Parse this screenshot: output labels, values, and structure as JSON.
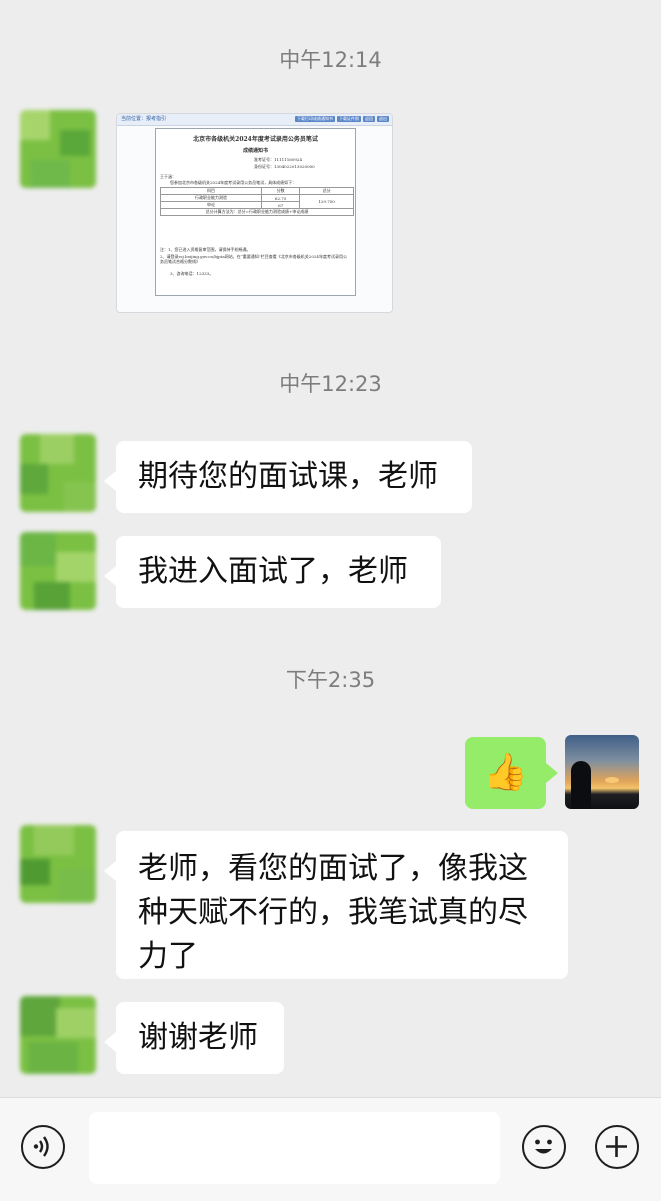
{
  "timestamps": [
    "中午12:14",
    "中午12:23",
    "下午2:35"
  ],
  "document_image": {
    "toolbar_label": "当前位置：报考指引",
    "toolbar_buttons": [
      "下载打印成绩通知书",
      "下载证件照",
      "返回",
      "退出"
    ],
    "title": "北京市各级机关2024年度考试录用公务员笔试",
    "subtitle": "成绩通知书",
    "exam_id_label": "准考证号：",
    "exam_id": "11111160924",
    "id_label": "身份证号：",
    "id_number": "1304022013020000",
    "greeting": "王于涵：",
    "body": "您参加北京市各级机关2024年度考试录用公务员笔试，具体成绩如下：",
    "table": {
      "headers": [
        "科目",
        "分数",
        "总分"
      ],
      "rows": [
        [
          "行政职业能力测验",
          "62.75",
          "129.750"
        ],
        [
          "申论",
          "67",
          ""
        ]
      ],
      "note": "总分计算方法为：总分=行政职业能力测验成绩+申论成绩"
    },
    "notes": [
      "注：1、您已进入资格复审范围，请保持手机畅通。",
      "2、请登录rsj.beijing.gov.cn/bjpta网站，在“重要通知”栏目查看《北京市各级机关2024年度考试录用公务员笔试合格分数线》",
      "3、咨询电话：12333。"
    ]
  },
  "messages": [
    {
      "from": "other",
      "text": "期待您的面试课，老师"
    },
    {
      "from": "other",
      "text": "我进入面试了，老师"
    },
    {
      "from": "me",
      "text": "👍"
    },
    {
      "from": "other",
      "text": "老师，看您的面试了，像我这种天赋不行的，我笔试真的尽力了"
    },
    {
      "from": "other",
      "text": "谢谢老师"
    }
  ],
  "input_bar": {
    "voice_icon": "voice-icon",
    "emoji_icon": "emoji-icon",
    "plus_icon": "plus-icon",
    "input_value": ""
  }
}
